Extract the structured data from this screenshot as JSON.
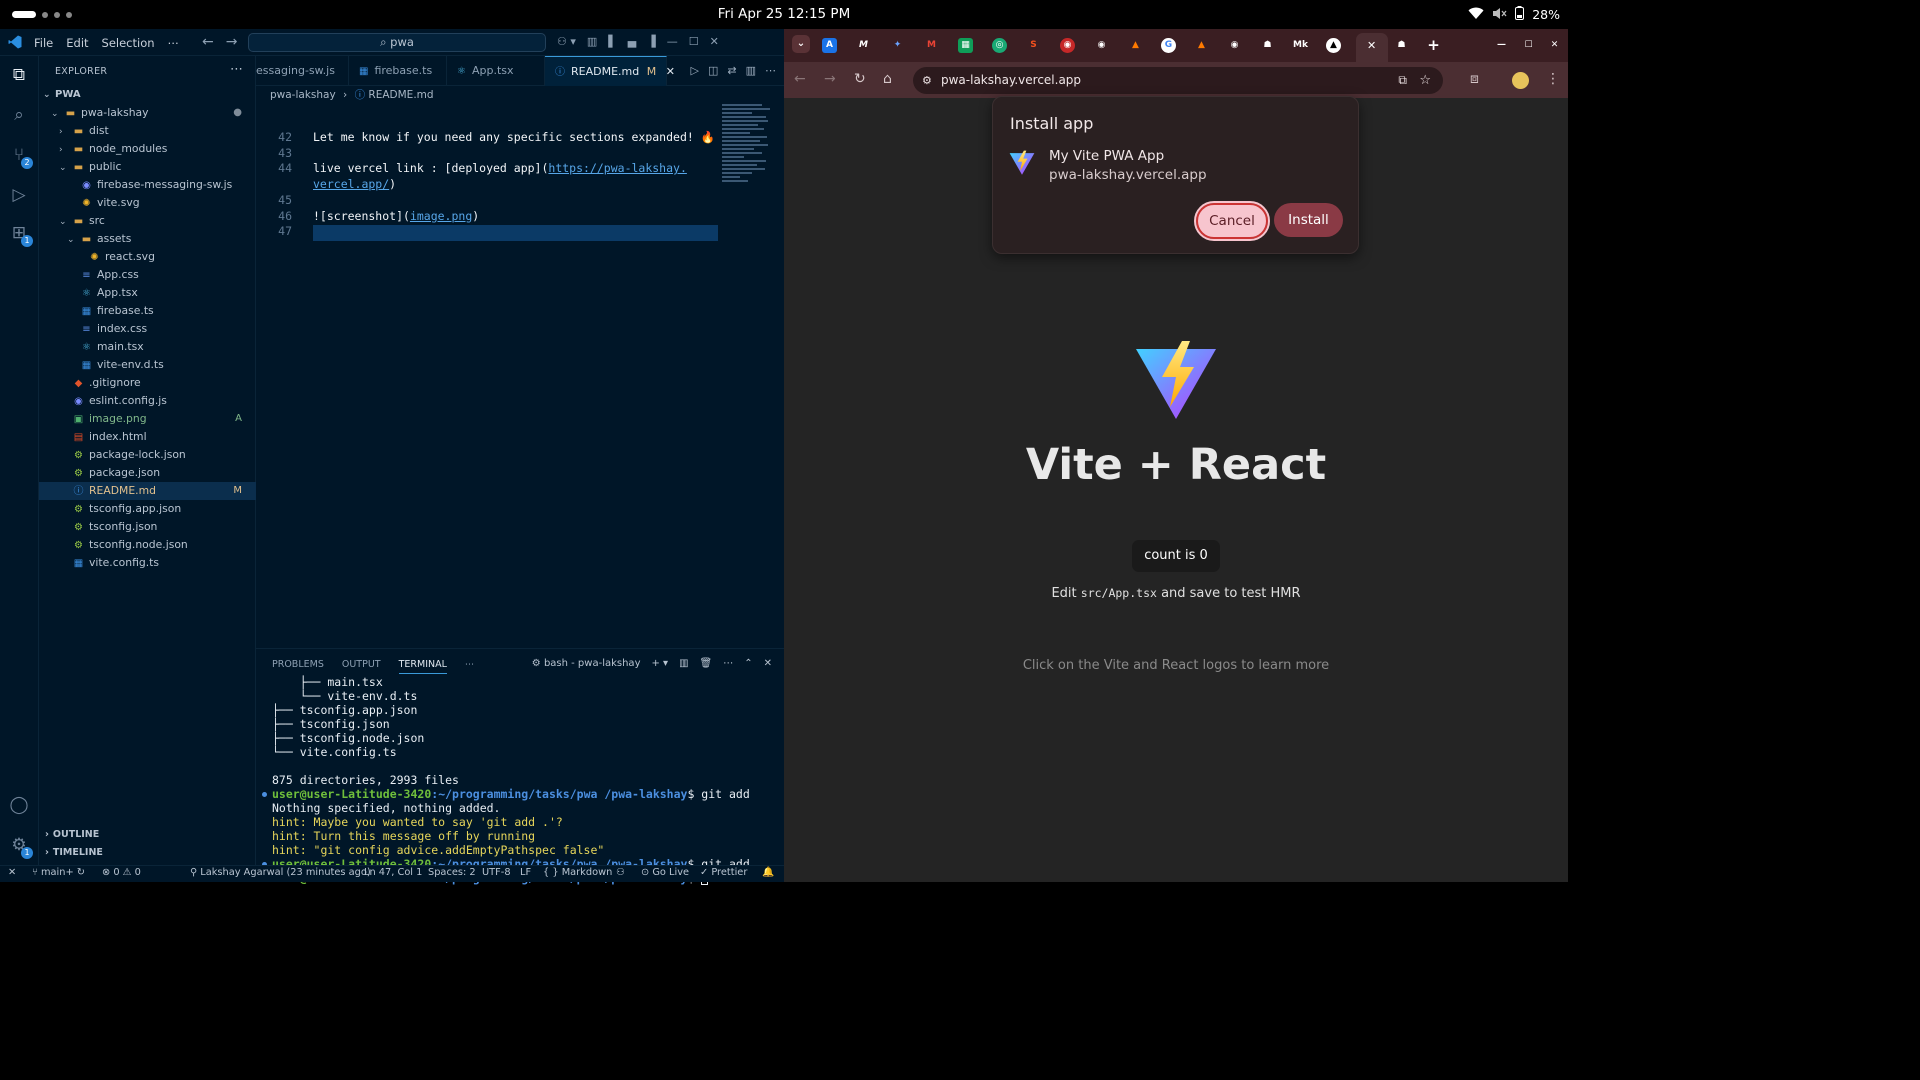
{
  "topbar": {
    "clock": "Fri Apr 25  12:15 PM",
    "battery": "28%"
  },
  "vscode": {
    "menu": [
      "File",
      "Edit",
      "Selection",
      "⋯"
    ],
    "search": "pwa",
    "explorer_title": "EXPLORER",
    "workspace": "PWA",
    "tree": [
      {
        "name": "pwa-lakshay",
        "depth": 0,
        "type": "folder-open",
        "status": "●"
      },
      {
        "name": "dist",
        "depth": 1,
        "type": "folder",
        "status": ""
      },
      {
        "name": "node_modules",
        "depth": 1,
        "type": "folder",
        "status": ""
      },
      {
        "name": "public",
        "depth": 1,
        "type": "folder-open",
        "status": ""
      },
      {
        "name": "firebase-messaging-sw.js",
        "depth": 2,
        "type": "file",
        "status": ""
      },
      {
        "name": "vite.svg",
        "depth": 2,
        "type": "file",
        "status": ""
      },
      {
        "name": "src",
        "depth": 1,
        "type": "folder-open",
        "status": ""
      },
      {
        "name": "assets",
        "depth": 2,
        "type": "folder-open",
        "status": ""
      },
      {
        "name": "react.svg",
        "depth": 3,
        "type": "file",
        "status": ""
      },
      {
        "name": "App.css",
        "depth": 2,
        "type": "file",
        "status": ""
      },
      {
        "name": "App.tsx",
        "depth": 2,
        "type": "file",
        "status": ""
      },
      {
        "name": "firebase.ts",
        "depth": 2,
        "type": "file",
        "status": ""
      },
      {
        "name": "index.css",
        "depth": 2,
        "type": "file",
        "status": ""
      },
      {
        "name": "main.tsx",
        "depth": 2,
        "type": "file",
        "status": ""
      },
      {
        "name": "vite-env.d.ts",
        "depth": 2,
        "type": "file",
        "status": ""
      },
      {
        "name": ".gitignore",
        "depth": 1,
        "type": "file",
        "status": ""
      },
      {
        "name": "eslint.config.js",
        "depth": 1,
        "type": "file",
        "status": ""
      },
      {
        "name": "image.png",
        "depth": 1,
        "type": "file",
        "status": "A"
      },
      {
        "name": "index.html",
        "depth": 1,
        "type": "file",
        "status": ""
      },
      {
        "name": "package-lock.json",
        "depth": 1,
        "type": "file",
        "status": ""
      },
      {
        "name": "package.json",
        "depth": 1,
        "type": "file",
        "status": ""
      },
      {
        "name": "README.md",
        "depth": 1,
        "type": "file",
        "status": "M"
      },
      {
        "name": "tsconfig.app.json",
        "depth": 1,
        "type": "file",
        "status": ""
      },
      {
        "name": "tsconfig.json",
        "depth": 1,
        "type": "file",
        "status": ""
      },
      {
        "name": "tsconfig.node.json",
        "depth": 1,
        "type": "file",
        "status": ""
      },
      {
        "name": "vite.config.ts",
        "depth": 1,
        "type": "file",
        "status": ""
      }
    ],
    "tabs": [
      {
        "label": "essaging-sw.js"
      },
      {
        "label": "firebase.ts"
      },
      {
        "label": "App.tsx"
      },
      {
        "label": "README.md",
        "suffix": "M",
        "close": "✕"
      }
    ],
    "breadcrumb": {
      "folder": "pwa-lakshay",
      "file": "README.md"
    },
    "code": [
      {
        "n": "42",
        "text": "Let me know if you need any specific sections expanded! 🔥"
      },
      {
        "n": "43",
        "text": ""
      },
      {
        "n": "44",
        "text": "live vercel link : [deployed app](",
        "link": "https://pwa-lakshay.",
        "after": ""
      },
      {
        "n": "",
        "text": "",
        "link": "vercel.app/",
        "after": ")"
      },
      {
        "n": "45",
        "text": ""
      },
      {
        "n": "46",
        "text": "![screenshot](",
        "link": "image.png",
        "after": ")"
      },
      {
        "n": "47",
        "text": ""
      }
    ],
    "panel_tabs": [
      "PROBLEMS",
      "OUTPUT",
      "TERMINAL",
      "⋯"
    ],
    "terminal_name": "bash - pwa-lakshay",
    "terminal": {
      "tree_lines": [
        "    ├── main.tsx",
        "    └── vite-env.d.ts",
        "├── tsconfig.app.json",
        "├── tsconfig.json",
        "├── tsconfig.node.json",
        "└── vite.config.ts"
      ],
      "summary": "875 directories, 2993 files",
      "prompt_user": "user@user-Latitude-3420",
      "prompt_path": "~/programming/tasks/pwa /pwa-lakshay",
      "cmd1": "$ git add",
      "out1": "Nothing specified, nothing added.",
      "hints": [
        "hint: Maybe you wanted to say 'git add .'?",
        "hint: Turn this message off by running",
        "hint: \"git config advice.addEmptyPathspec false\""
      ],
      "cmd2": "$ git add .",
      "cmd3": "$ "
    },
    "outline": "OUTLINE",
    "timeline": "TIMELINE",
    "status": {
      "branch": "main+",
      "problems": "⊗ 0 ⚠ 0",
      "author": "Lakshay Agarwal (23 minutes ago)",
      "pos": "Ln 47, Col 1",
      "spaces": "Spaces: 2",
      "enc": "UTF-8",
      "eol": "LF",
      "lang": "{ } Markdown",
      "golive": "Go Live",
      "prettier": "✓ Prettier"
    }
  },
  "chrome": {
    "url": "pwa-lakshay.vercel.app",
    "install": {
      "title": "Install app",
      "app_name": "My Vite PWA App",
      "app_url": "pwa-lakshay.vercel.app",
      "cancel": "Cancel",
      "install": "Install"
    },
    "page": {
      "title": "Vite + React",
      "count": "count is 0",
      "edit_pre": "Edit ",
      "edit_code": "src/App.tsx",
      "edit_post": " and save to test HMR",
      "docs": "Click on the Vite and React logos to learn more"
    }
  },
  "colors": {
    "vscode_bg": "#001628",
    "chrome_tab_strip": "#3a1e22",
    "install_button": "#8a3a45",
    "cancel_button": "#f7c5ce"
  }
}
